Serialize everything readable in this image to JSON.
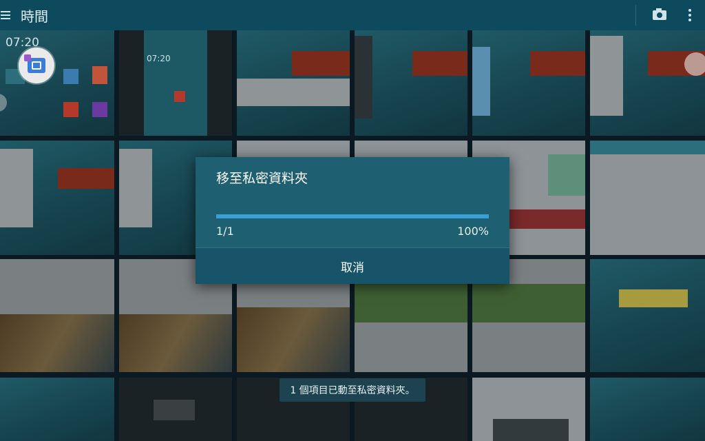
{
  "header": {
    "title": "時間",
    "menu_icon": "hamburger-menu-icon",
    "camera_icon": "camera-icon",
    "overflow_icon": "more-vert-icon"
  },
  "grid": {
    "clock_text": "07:20",
    "clock_text_2": "07:20"
  },
  "dialog": {
    "title": "移至私密資料夾",
    "progress_count": "1/1",
    "progress_percent": "100%",
    "progress_fraction": 1.0,
    "cancel_label": "取消"
  },
  "toast": {
    "message": "1 個項目已動至私密資料夾。"
  },
  "colors": {
    "header_bg": "#0d4a5e",
    "dialog_bg": "#1f5f72",
    "progress_fill": "#3a9fd6"
  }
}
